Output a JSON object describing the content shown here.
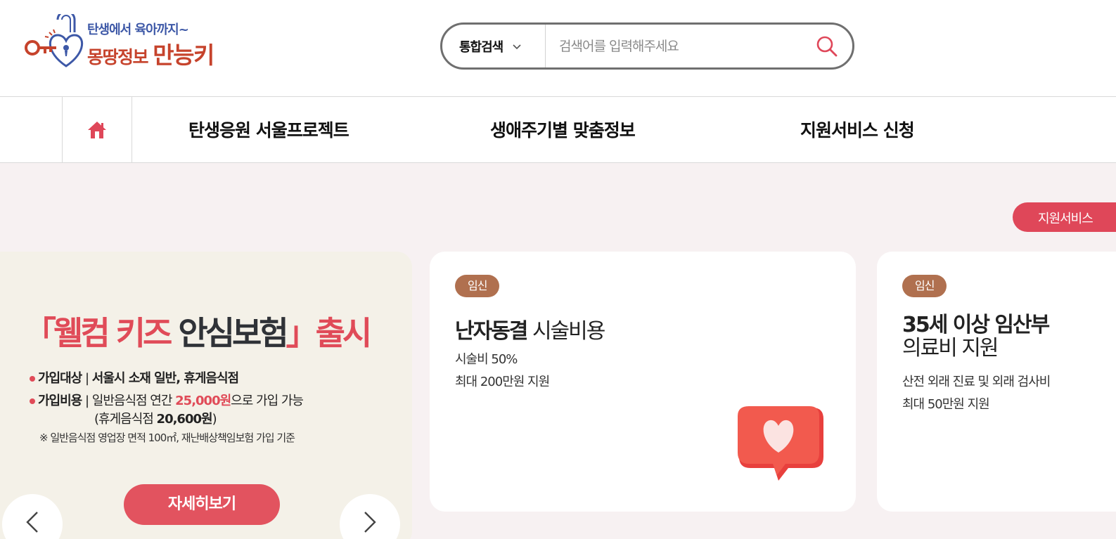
{
  "header": {
    "logo": {
      "line1": "탄생에서 육아까지~",
      "line2_a": "몽땅정보 ",
      "line2_b": "만능키"
    },
    "search": {
      "scope_label": "통합검색",
      "placeholder": "검색어를 입력해주세요",
      "value": ""
    }
  },
  "nav": {
    "items": [
      {
        "label": "탄생응원 서울프로젝트"
      },
      {
        "label": "생애주기별 맞춤정보"
      },
      {
        "label": "지원서비스 신청"
      }
    ]
  },
  "main": {
    "pill_label": "지원서비스",
    "banner": {
      "title_open": "「웰컴 키즈 ",
      "title_mid": "안심보험",
      "title_close": "」출시",
      "line1_label": "가입대상",
      "line1_text": "서울시 소재 일반, 휴게음식점",
      "line2_label": "가입비용",
      "line2_pre": "일반음식점 연간 ",
      "line2_amount": "25,000원",
      "line2_post": "으로 가입 가능",
      "line3_pre": "(휴게음식점 ",
      "line3_amount": "20,600원",
      "line3_post": ")",
      "note": "※ 일반음식점 영업장 면적 100㎡, 재난배상책임보험 가입 기준",
      "button": "자세히보기"
    },
    "cards": [
      {
        "tag": "임신",
        "title_bold": "난자동결",
        "title_rest": " 시술비용",
        "line1": "시술비 50%",
        "line2": "최대 200만원 지원"
      },
      {
        "tag": "임신",
        "title_bold": "35세 이상 임산부",
        "title_rest": "의료비 지원",
        "line1": "산전 외래 진료 및 외래 검사비",
        "line2": "최대 50만원 지원"
      }
    ]
  },
  "colors": {
    "accent": "#df4759",
    "tag": "#b0704f",
    "logo_blue": "#3d58a7",
    "logo_orange": "#c6432c",
    "main_bg": "#f7f1f2"
  }
}
